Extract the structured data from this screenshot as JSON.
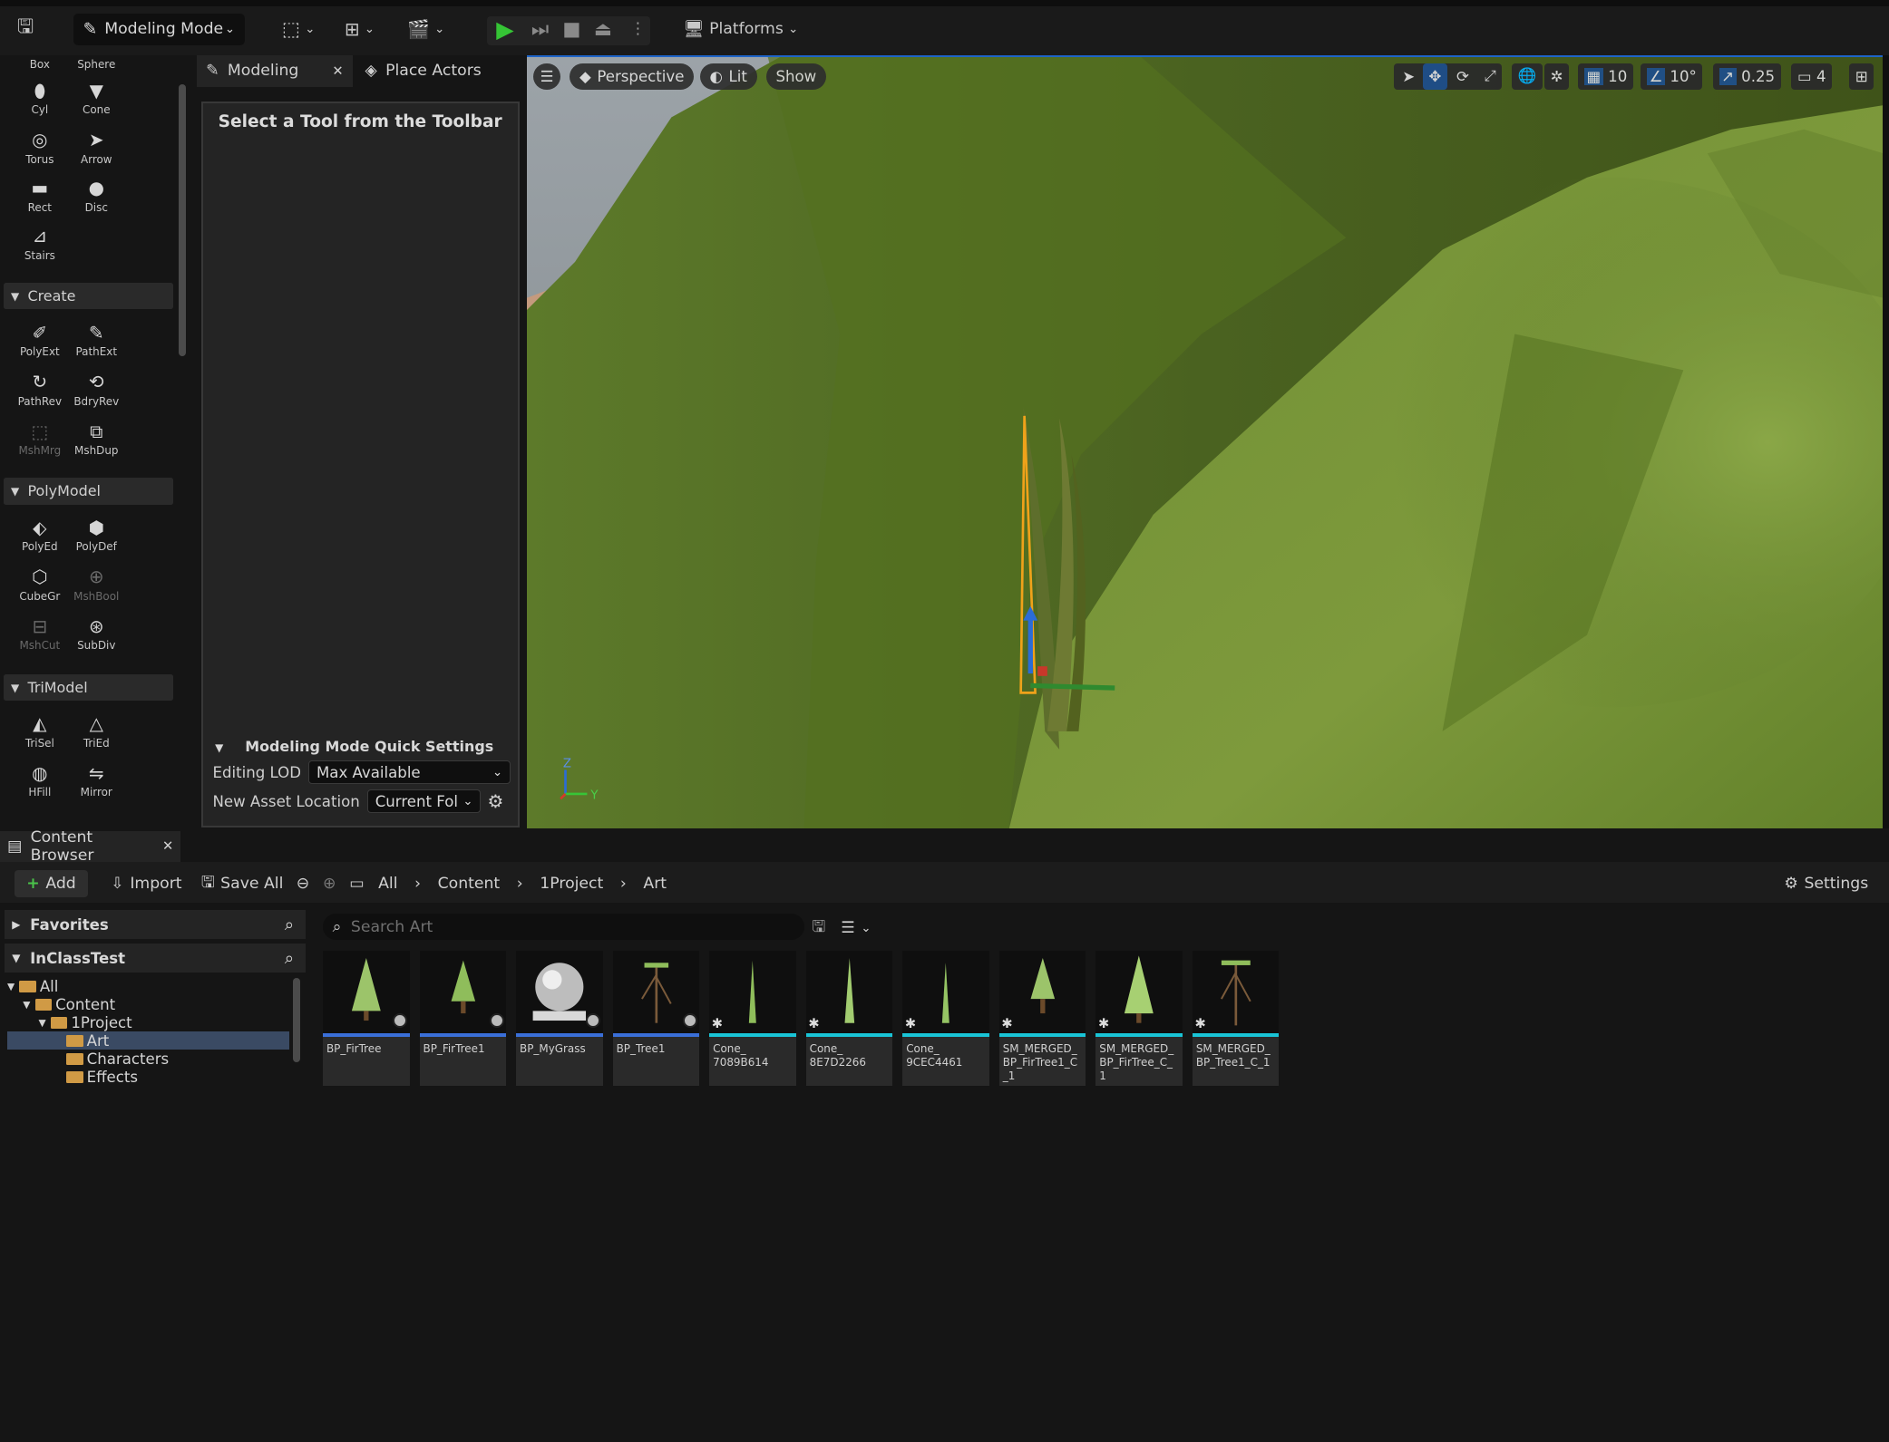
{
  "toolbar": {
    "mode_label": "Modeling Mode",
    "platforms_label": "Platforms"
  },
  "modes_panel": {
    "top_items": [
      {
        "label": "Box",
        "icon": "box-icon",
        "enabled": true
      },
      {
        "label": "Sphere",
        "icon": "sphere-icon",
        "enabled": true
      },
      {
        "label": "Cyl",
        "icon": "cylinder-icon",
        "enabled": true
      },
      {
        "label": "Cone",
        "icon": "cone-icon",
        "enabled": true
      },
      {
        "label": "Torus",
        "icon": "torus-icon",
        "enabled": true
      },
      {
        "label": "Arrow",
        "icon": "arrow-icon",
        "enabled": true
      },
      {
        "label": "Rect",
        "icon": "rect-icon",
        "enabled": true
      },
      {
        "label": "Disc",
        "icon": "disc-icon",
        "enabled": true
      },
      {
        "label": "Stairs",
        "icon": "stairs-icon",
        "enabled": true
      }
    ],
    "sections": [
      {
        "title": "Create",
        "items": [
          {
            "label": "PolyExt",
            "icon": "poly-extrude-icon",
            "enabled": true
          },
          {
            "label": "PathExt",
            "icon": "path-extrude-icon",
            "enabled": true
          },
          {
            "label": "PathRev",
            "icon": "path-revolve-icon",
            "enabled": true
          },
          {
            "label": "BdryRev",
            "icon": "boundary-revolve-icon",
            "enabled": true
          },
          {
            "label": "MshMrg",
            "icon": "mesh-merge-icon",
            "enabled": false
          },
          {
            "label": "MshDup",
            "icon": "mesh-duplicate-icon",
            "enabled": true
          }
        ]
      },
      {
        "title": "PolyModel",
        "items": [
          {
            "label": "PolyEd",
            "icon": "poly-edit-icon",
            "enabled": true
          },
          {
            "label": "PolyDef",
            "icon": "poly-deform-icon",
            "enabled": true
          },
          {
            "label": "CubeGr",
            "icon": "cube-grid-icon",
            "enabled": true
          },
          {
            "label": "MshBool",
            "icon": "mesh-boolean-icon",
            "enabled": false
          },
          {
            "label": "MshCut",
            "icon": "mesh-cut-icon",
            "enabled": false
          },
          {
            "label": "SubDiv",
            "icon": "subdivide-icon",
            "enabled": true
          }
        ]
      },
      {
        "title": "TriModel",
        "items": [
          {
            "label": "TriSel",
            "icon": "tri-select-icon",
            "enabled": true
          },
          {
            "label": "TriEd",
            "icon": "tri-edit-icon",
            "enabled": true
          },
          {
            "label": "HFill",
            "icon": "hole-fill-icon",
            "enabled": true
          },
          {
            "label": "Mirror",
            "icon": "mirror-icon",
            "enabled": true
          }
        ]
      }
    ]
  },
  "tool_panel": {
    "tabs": [
      "Modeling",
      "Place Actors"
    ],
    "heading": "Select a Tool from the Toolbar",
    "quick_settings_title": "Modeling Mode Quick Settings",
    "editing_lod_label": "Editing LOD",
    "editing_lod_value": "Max Available",
    "new_asset_location_label": "New Asset Location",
    "new_asset_location_value": "Current Fol"
  },
  "viewport": {
    "view_mode": "Perspective",
    "lighting": "Lit",
    "show_label": "Show",
    "grid_snap": "10",
    "rotation_snap": "10°",
    "scale_snap": "0.25",
    "camera_speed": "4",
    "axis_z": "Z",
    "axis_y": "Y"
  },
  "content_browser": {
    "tab_title": "Content Browser",
    "add_label": "Add",
    "import_label": "Import",
    "save_all_label": "Save All",
    "breadcrumbs": [
      "All",
      "Content",
      "1Project",
      "Art"
    ],
    "settings_label": "Settings",
    "favorites_label": "Favorites",
    "project_label": "InClassTest",
    "tree": [
      {
        "label": "All",
        "depth": 0,
        "selected": false
      },
      {
        "label": "Content",
        "depth": 1,
        "selected": false
      },
      {
        "label": "1Project",
        "depth": 2,
        "selected": false
      },
      {
        "label": "Art",
        "depth": 3,
        "selected": true
      },
      {
        "label": "Characters",
        "depth": 3,
        "selected": false
      },
      {
        "label": "Effects",
        "depth": 3,
        "selected": false
      }
    ],
    "search_placeholder": "Search Art",
    "assets": [
      {
        "name": "BP_FirTree",
        "kind": "blueprint",
        "bar_color": "#3a6fd8"
      },
      {
        "name": "BP_FirTree1",
        "kind": "blueprint",
        "bar_color": "#3a6fd8"
      },
      {
        "name": "BP_MyGrass",
        "kind": "blueprint",
        "bar_color": "#3a6fd8"
      },
      {
        "name": "BP_Tree1",
        "kind": "blueprint",
        "bar_color": "#3a6fd8"
      },
      {
        "name": "Cone_ 7089B614",
        "kind": "static-mesh",
        "bar_color": "#19c4d6"
      },
      {
        "name": "Cone_ 8E7D2266",
        "kind": "static-mesh",
        "bar_color": "#19c4d6"
      },
      {
        "name": "Cone_ 9CEC4461",
        "kind": "static-mesh",
        "bar_color": "#19c4d6"
      },
      {
        "name": "SM_MERGED_ BP_FirTree1_C _1",
        "kind": "static-mesh",
        "bar_color": "#19c4d6"
      },
      {
        "name": "SM_MERGED_ BP_FirTree_C_ 1",
        "kind": "static-mesh",
        "bar_color": "#19c4d6"
      },
      {
        "name": "SM_MERGED_ BP_Tree1_C_1",
        "kind": "static-mesh",
        "bar_color": "#19c4d6"
      }
    ]
  }
}
